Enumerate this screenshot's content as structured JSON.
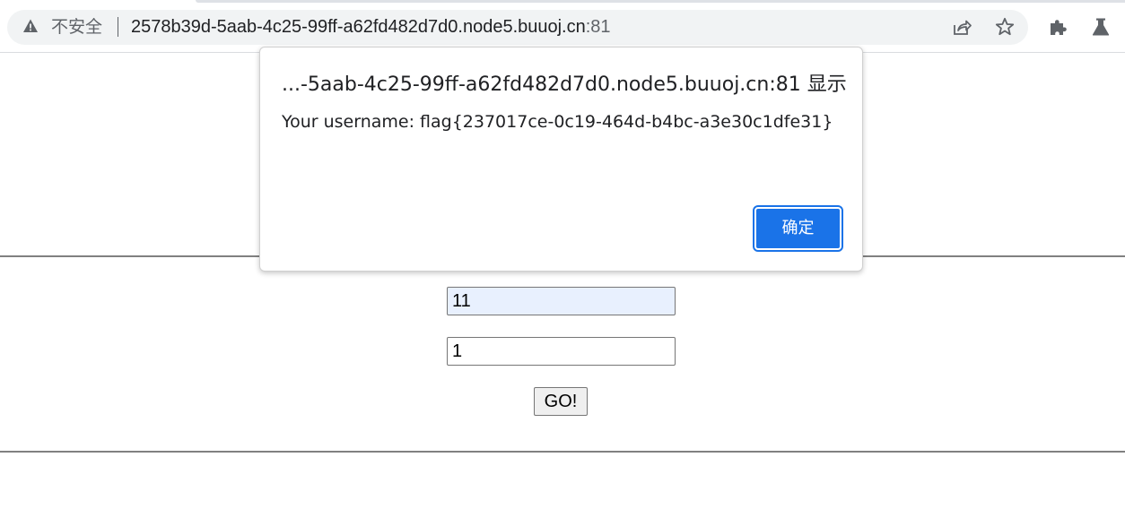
{
  "browser": {
    "security_label": "不安全",
    "url_host": "2578b39d-5aab-4c25-99ff-a62fd482d7d0.node5.buuoj.cn",
    "url_port": ":81",
    "icons": [
      "warning-icon",
      "share-icon",
      "bookmark-star-icon",
      "extensions-icon",
      "labs-flask-icon"
    ]
  },
  "form": {
    "username_value": "11",
    "password_value": "1",
    "submit_label": "GO!"
  },
  "alert": {
    "title": "...-5aab-4c25-99ff-a62fd482d7d0.node5.buuoj.cn:81 显示",
    "message": "Your username: flag{237017ce-0c19-464d-b4bc-a3e30c1dfe31}",
    "ok_label": "确定"
  },
  "colors": {
    "accent": "#1a73e8",
    "autofill_bg": "#e8f0fe",
    "omnibox_bg": "#f1f3f4"
  }
}
